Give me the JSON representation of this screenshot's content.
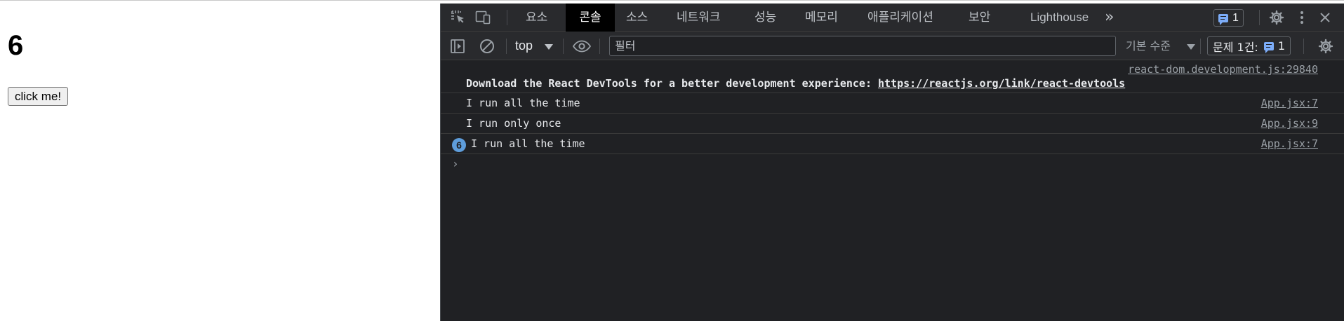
{
  "app": {
    "counter": "6",
    "button_label": "click me!"
  },
  "devtools": {
    "tabs": [
      "요소",
      "콘솔",
      "소스",
      "네트워크",
      "성능",
      "메모리",
      "애플리케이션",
      "보안",
      "Lighthouse"
    ],
    "active_tab": "콘솔",
    "overflow": "»",
    "messages_count": "1",
    "toolbar": {
      "context": "top",
      "filter_placeholder": "필터",
      "levels": "기본 수준",
      "issues_label": "문제 1건:",
      "issues_count": "1"
    },
    "console": [
      {
        "source": "react-dom.development.js:29840",
        "text_bold": "Download the React DevTools for a better development experience: ",
        "link": "https://reactjs.org/link/react-devtools"
      },
      {
        "text": "I run all the time",
        "source": "App.jsx:7"
      },
      {
        "text": "I run only once",
        "source": "App.jsx:9"
      },
      {
        "repeat": "6",
        "text": "I run all the time",
        "source": "App.jsx:7"
      }
    ],
    "prompt": "›"
  },
  "colors": {
    "devtools_bg": "#202124",
    "toolbar_bg": "#292a2d",
    "active_tab_bg": "#000000",
    "repeat_badge": "#5e9ddb",
    "message_icon": "#7cacf8"
  },
  "icons": [
    "inspect-element-icon",
    "device-toolbar-icon",
    "sidebar-toggle-icon",
    "clear-console-icon",
    "eye-icon",
    "settings-gear-icon",
    "more-menu-icon",
    "close-icon",
    "message-icon"
  ]
}
